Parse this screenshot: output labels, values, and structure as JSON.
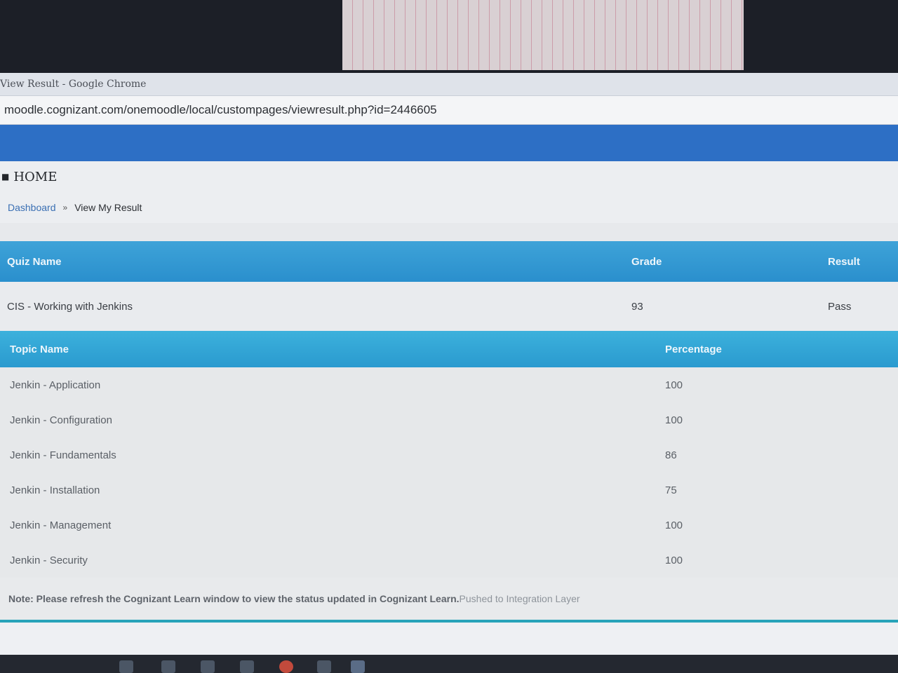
{
  "window": {
    "title": "View Result - Google Chrome",
    "url": "moodle.cognizant.com/onemoodle/local/custompages/viewresult.php?id=2446605"
  },
  "nav": {
    "home_label": "HOME"
  },
  "breadcrumb": {
    "items": [
      {
        "label": "Dashboard"
      },
      {
        "label": "View My Result"
      }
    ],
    "separator": "»"
  },
  "quiz_table": {
    "headers": {
      "name": "Quiz Name",
      "grade": "Grade",
      "result": "Result"
    },
    "row": {
      "name": "CIS - Working with Jenkins",
      "grade": "93",
      "result": "Pass"
    }
  },
  "topic_table": {
    "headers": {
      "name": "Topic Name",
      "percentage": "Percentage"
    },
    "rows": [
      {
        "name": "Jenkin - Application",
        "percentage": "100"
      },
      {
        "name": "Jenkin - Configuration",
        "percentage": "100"
      },
      {
        "name": "Jenkin - Fundamentals",
        "percentage": "86"
      },
      {
        "name": "Jenkin - Installation",
        "percentage": "75"
      },
      {
        "name": "Jenkin - Management",
        "percentage": "100"
      },
      {
        "name": "Jenkin - Security",
        "percentage": "100"
      }
    ]
  },
  "note": {
    "text": "Note: Please refresh the Cognizant Learn window to view the status updated in Cognizant Learn.",
    "extra": "Pushed to Integration Layer"
  },
  "colors": {
    "header_blue": "#2d6fc5",
    "table_header": "#2a8fcd",
    "accent_line": "#27a3b9"
  }
}
